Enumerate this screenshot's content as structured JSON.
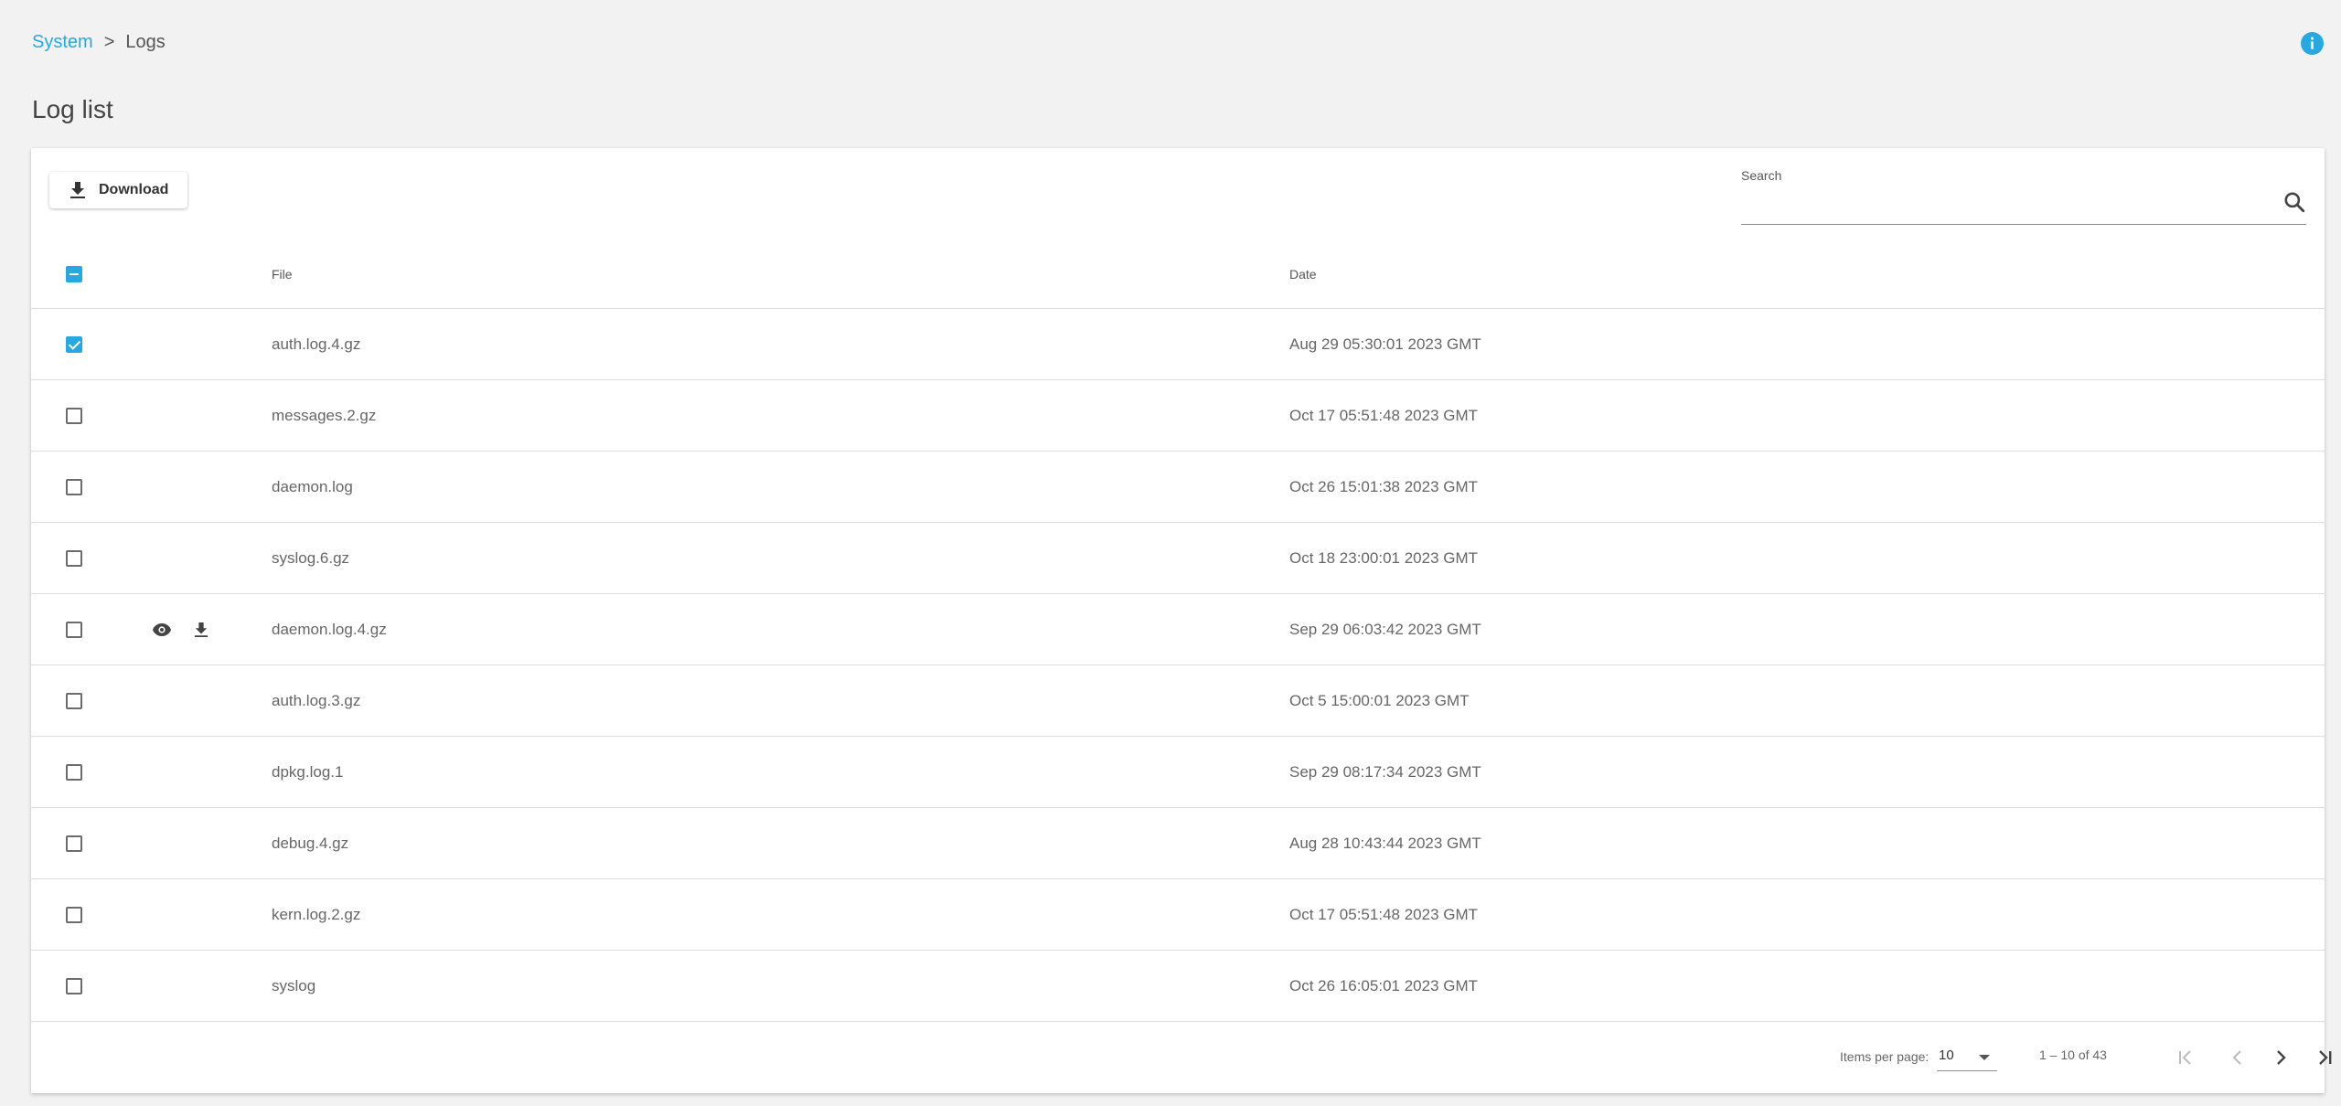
{
  "breadcrumb": {
    "parent": "System",
    "separator": ">",
    "current": "Logs"
  },
  "page": {
    "title": "Log list"
  },
  "toolbar": {
    "download_label": "Download"
  },
  "search": {
    "label": "Search",
    "value": "",
    "placeholder": ""
  },
  "table": {
    "columns": {
      "file": "File",
      "date": "Date"
    },
    "select_all_state": "indeterminate",
    "rows": [
      {
        "file": "auth.log.4.gz",
        "date": "Aug 29 05:30:01 2023 GMT",
        "checked": true
      },
      {
        "file": "messages.2.gz",
        "date": "Oct 17 05:51:48 2023 GMT",
        "checked": false
      },
      {
        "file": "daemon.log",
        "date": "Oct 26 15:01:38 2023 GMT",
        "checked": false
      },
      {
        "file": "syslog.6.gz",
        "date": "Oct 18 23:00:01 2023 GMT",
        "checked": false
      },
      {
        "file": "daemon.log.4.gz",
        "date": "Sep 29 06:03:42 2023 GMT",
        "checked": false,
        "hover_actions": [
          "eye-icon",
          "download-icon"
        ]
      },
      {
        "file": "auth.log.3.gz",
        "date": "Oct 5 15:00:01 2023 GMT",
        "checked": false
      },
      {
        "file": "dpkg.log.1",
        "date": "Sep 29 08:17:34 2023 GMT",
        "checked": false
      },
      {
        "file": "debug.4.gz",
        "date": "Aug 28 10:43:44 2023 GMT",
        "checked": false
      },
      {
        "file": "kern.log.2.gz",
        "date": "Oct 17 05:51:48 2023 GMT",
        "checked": false
      },
      {
        "file": "syslog",
        "date": "Oct 26 16:05:01 2023 GMT",
        "checked": false
      }
    ]
  },
  "pagination": {
    "items_per_page_label": "Items per page:",
    "items_per_page": "10",
    "range": "1 – 10 of 43"
  },
  "colors": {
    "accent": "#29a8df",
    "background": "#f2f2f2"
  }
}
